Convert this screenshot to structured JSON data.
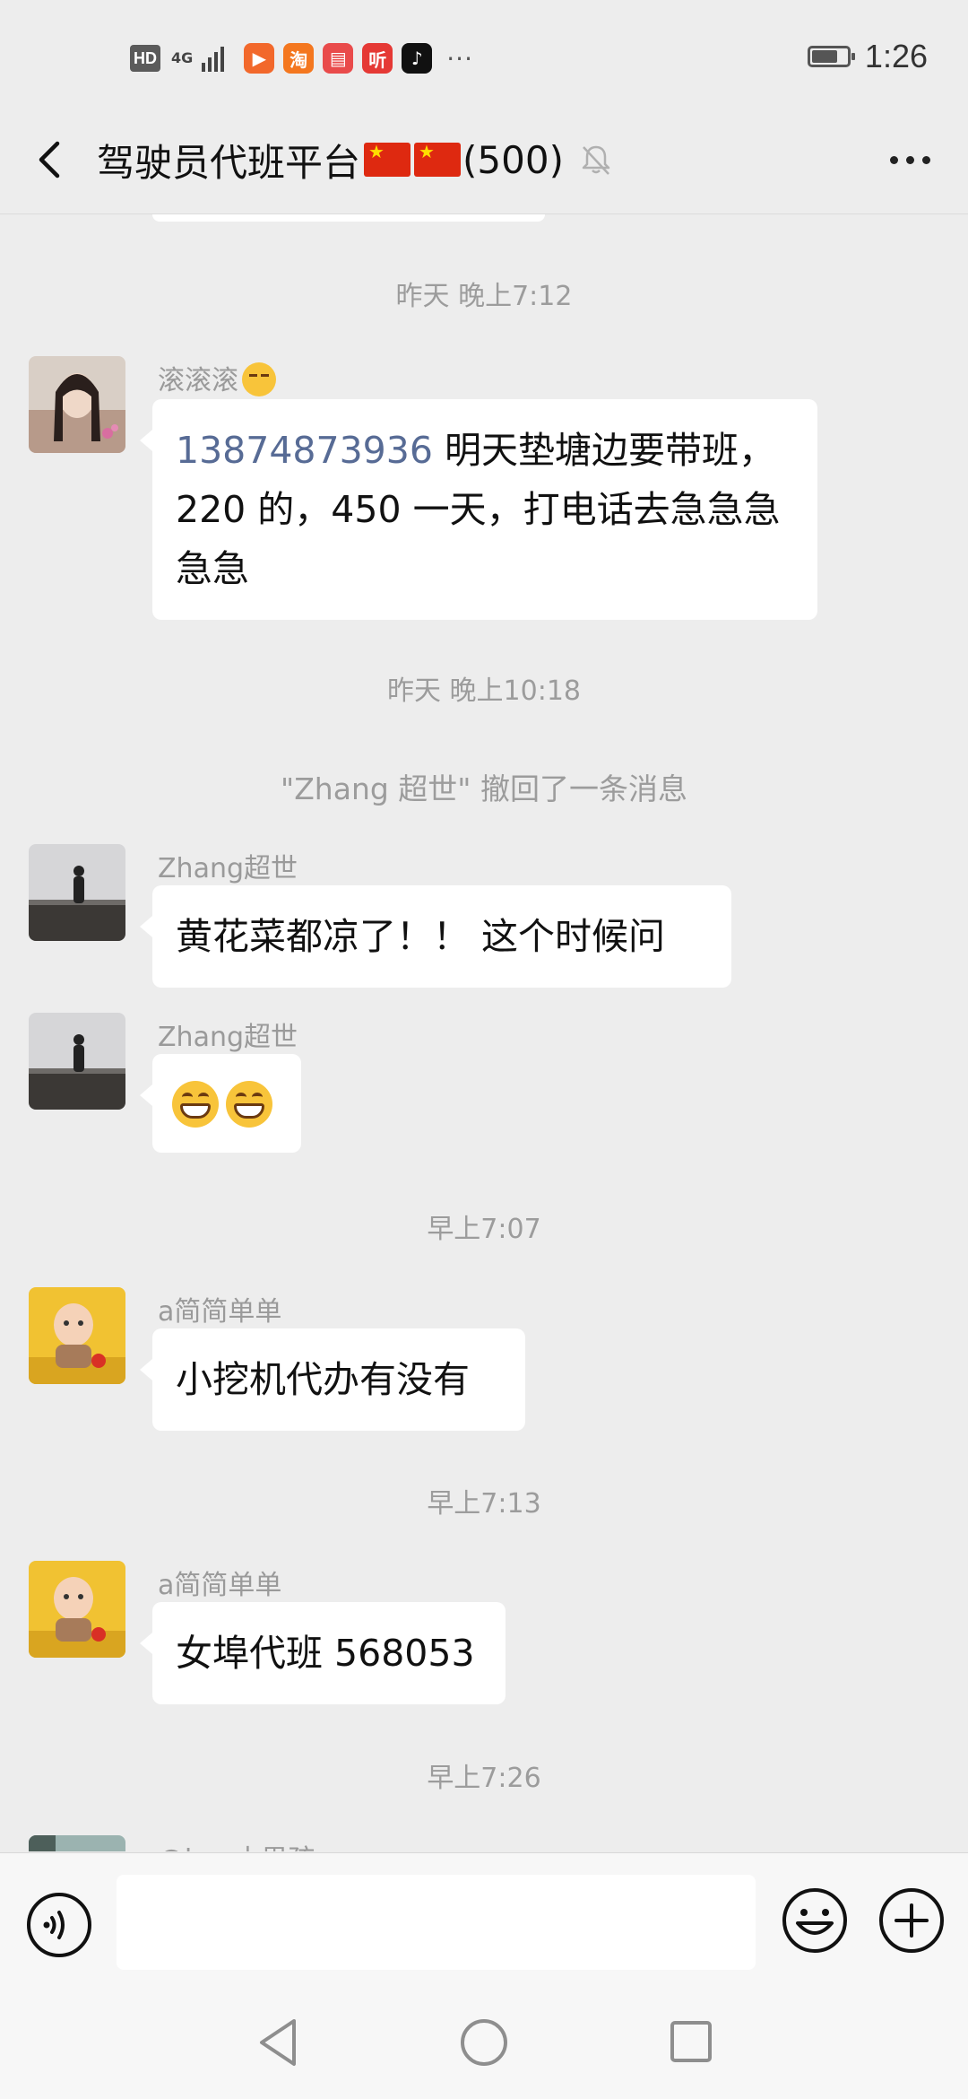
{
  "status_bar": {
    "hd_label": "HD",
    "network_label": "4G",
    "app_icons": [
      {
        "name": "video-app-icon",
        "glyph": "▶",
        "color": "#f2682b"
      },
      {
        "name": "taobao-app-icon",
        "glyph": "淘",
        "color": "#f4771f"
      },
      {
        "name": "reader-app-icon",
        "glyph": "▤",
        "color": "#e94b4b"
      },
      {
        "name": "ting-app-icon",
        "glyph": "听",
        "color": "#e53935"
      },
      {
        "name": "tiktok-app-icon",
        "glyph": "♪",
        "color": "#111111"
      }
    ],
    "overflow": "···",
    "battery_level": 0.75,
    "time": "1:26"
  },
  "header": {
    "title": "驾驶员代班平台",
    "member_count": "(500)"
  },
  "messages": {
    "ts1": "昨天 晚上7:12",
    "m1_sender": "滚滚滚",
    "m1_phone": "13874873936",
    "m1_text": " 明天垫塘边要带班，220 的，450 一天，打电话去急急急急急",
    "ts2": "昨天 晚上10:18",
    "sys1": "\"Zhang 超世\" 撤回了一条消息",
    "m2_sender": "Zhang超世",
    "m2_text": "黄花菜都凉了！！ 这个时候问",
    "m3_sender": "Zhang超世",
    "ts3": "早上7:07",
    "m4_sender": "a简简单单",
    "m4_text": "小挖机代办有没有",
    "ts4": "早上7:13",
    "m5_sender": "a简简单单",
    "m5_text": "女埠代班 568053",
    "ts5": "早上7:26",
    "m6_sender": "@hey小男孩"
  },
  "input": {
    "value": "",
    "placeholder": ""
  },
  "colors": {
    "background": "#ededed",
    "link": "#576b95",
    "timestamp": "#9c9c9c"
  }
}
